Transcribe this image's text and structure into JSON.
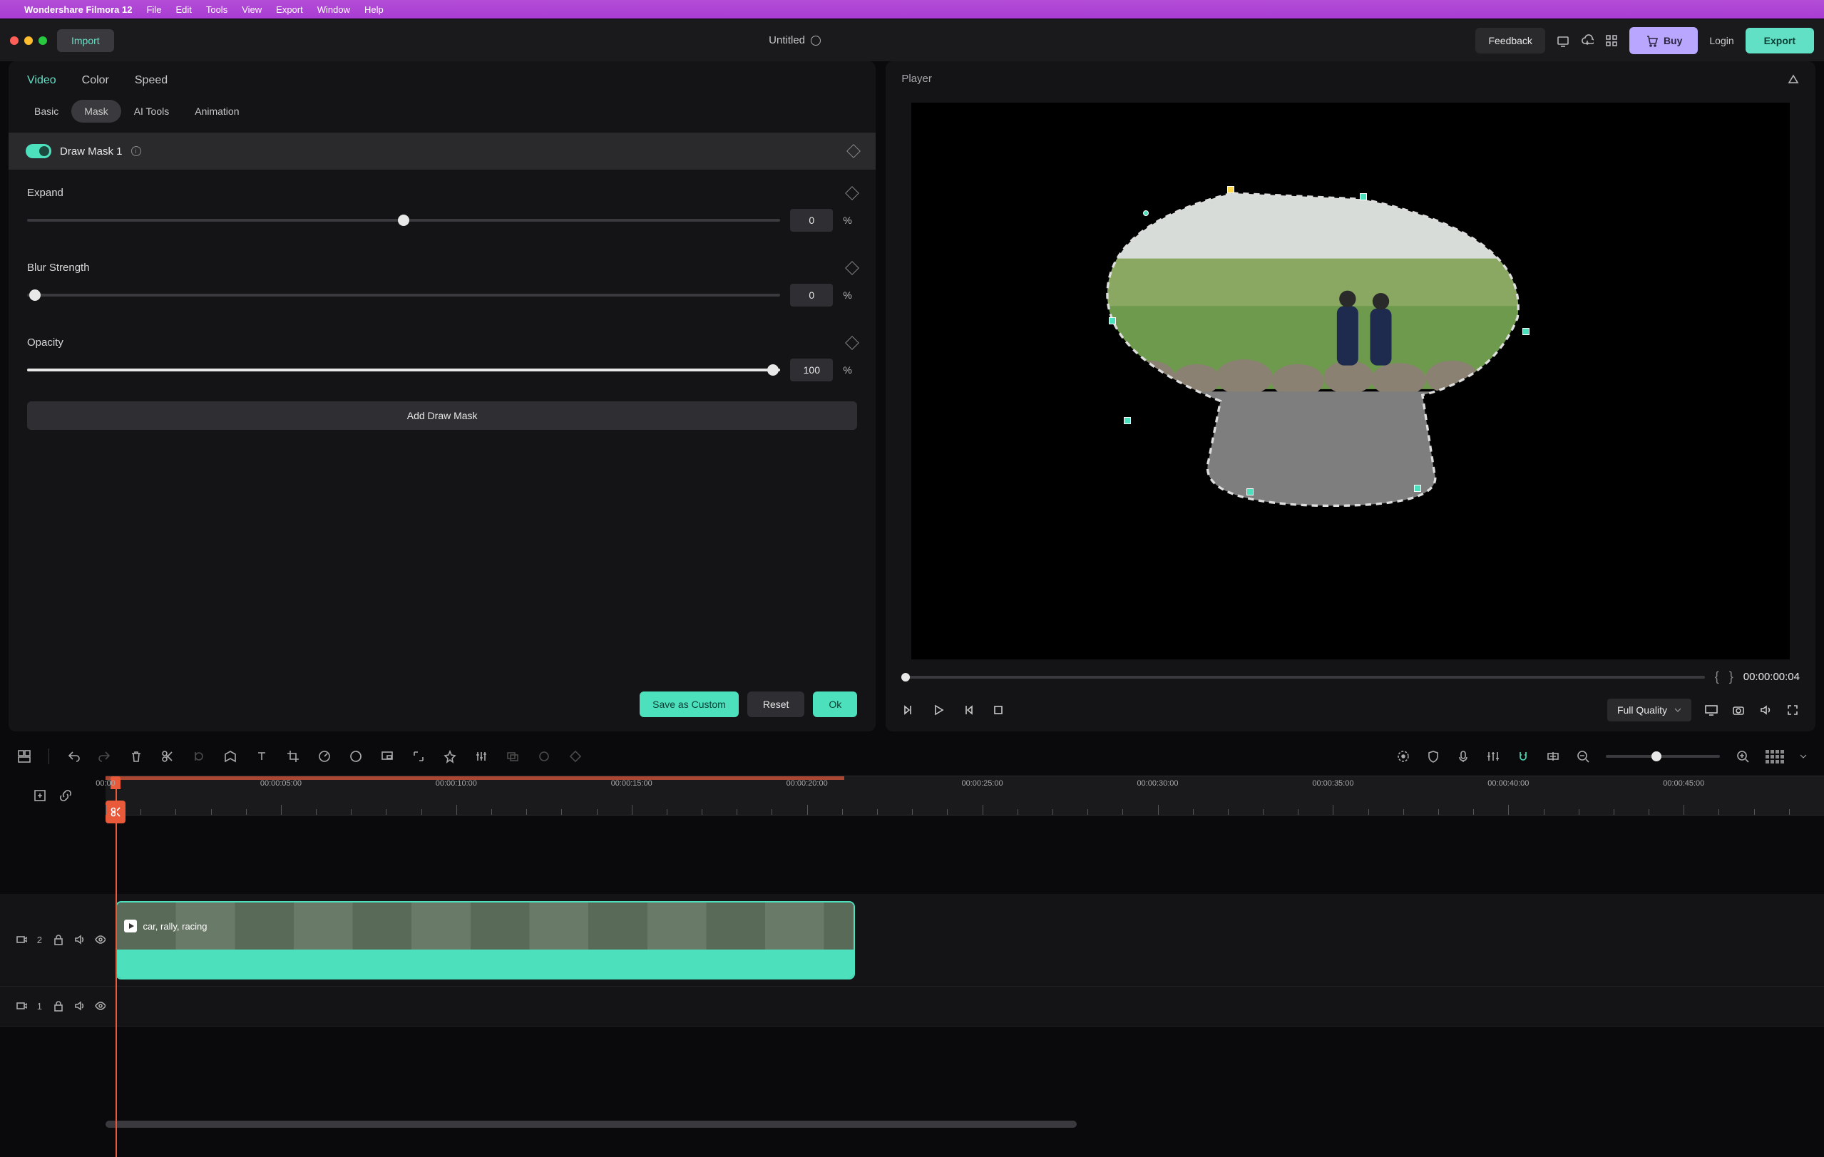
{
  "menubar": {
    "appname": "Wondershare Filmora 12",
    "items": [
      "File",
      "Edit",
      "Tools",
      "View",
      "Export",
      "Window",
      "Help"
    ]
  },
  "window": {
    "import_label": "Import",
    "title": "Untitled",
    "feedback_label": "Feedback",
    "buy_label": "Buy",
    "login_label": "Login",
    "export_label": "Export"
  },
  "inspector": {
    "main_tabs": [
      "Video",
      "Color",
      "Speed"
    ],
    "active_main": "Video",
    "sub_tabs": [
      "Basic",
      "Mask",
      "AI Tools",
      "Animation"
    ],
    "active_sub": "Mask",
    "mask_name": "Draw Mask 1",
    "expand": {
      "label": "Expand",
      "value": "0",
      "unit": "%",
      "pct": 50
    },
    "blur": {
      "label": "Blur Strength",
      "value": "0",
      "unit": "%",
      "pct": 0
    },
    "opacity": {
      "label": "Opacity",
      "value": "100",
      "unit": "%",
      "pct": 100
    },
    "add_mask_label": "Add Draw Mask",
    "save_custom_label": "Save as Custom",
    "reset_label": "Reset",
    "ok_label": "Ok"
  },
  "player": {
    "title": "Player",
    "timecode": "00:00:00:04",
    "quality_label": "Full Quality"
  },
  "ruler": {
    "ticks": [
      "00:00",
      "00:00:05:00",
      "00:00:10:00",
      "00:00:15:00",
      "00:00:20:00",
      "00:00:25:00",
      "00:00:30:00",
      "00:00:35:00",
      "00:00:40:00",
      "00:00:45:00"
    ]
  },
  "tracks": {
    "track2": {
      "num": "2"
    },
    "track1": {
      "num": "1"
    },
    "clip_label": "car, rally, racing"
  }
}
